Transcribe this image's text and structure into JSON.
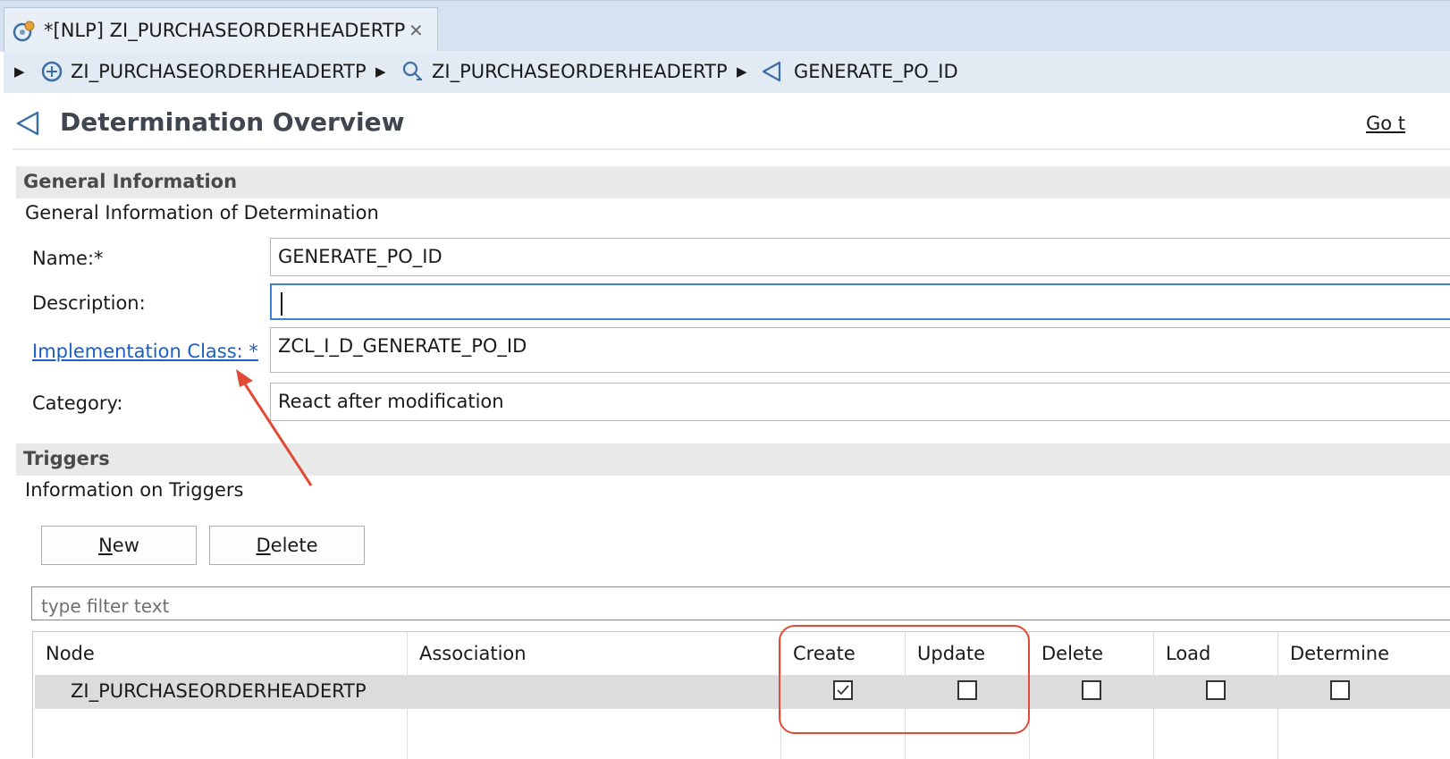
{
  "tab": {
    "title": "*[NLP] ZI_PURCHASEORDERHEADERTP",
    "icon": "behavior-definition-icon",
    "close_icon": "close-icon"
  },
  "breadcrumb": {
    "items": [
      {
        "label": "ZI_PURCHASEORDERHEADERTP",
        "icon": "behavior-definition-icon"
      },
      {
        "label": "ZI_PURCHASEORDERHEADERTP",
        "icon": "node-icon"
      },
      {
        "label": "GENERATE_PO_ID",
        "icon": "determination-icon"
      }
    ]
  },
  "header": {
    "title": "Determination Overview",
    "goto_link": "Go t"
  },
  "general": {
    "title": "General Information",
    "description": "General Information of Determination",
    "name_label": "Name:*",
    "name_value": "GENERATE_PO_ID",
    "description_label": "Description:",
    "description_value": "",
    "impl_class_label": "Implementation Class: *",
    "impl_class_value": "ZCL_I_D_GENERATE_PO_ID",
    "category_label": "Category:",
    "category_value": "React after modification"
  },
  "triggers": {
    "title": "Triggers",
    "description": "Information on Triggers",
    "new_button": {
      "pre": "",
      "key": "N",
      "post": "ew"
    },
    "delete_button": {
      "pre": "",
      "key": "D",
      "post": "elete"
    },
    "filter_placeholder": "type filter text",
    "columns": [
      "Node",
      "Association",
      "Create",
      "Update",
      "Delete",
      "Load",
      "Determine"
    ],
    "rows": [
      {
        "node": "ZI_PURCHASEORDERHEADERTP",
        "association": "",
        "create": true,
        "update": false,
        "delete": false,
        "load": false,
        "determine": false
      }
    ]
  },
  "colors": {
    "accent_link": "#1a5fc7",
    "annotation": "#e14b35",
    "focus": "#3b82d6"
  }
}
